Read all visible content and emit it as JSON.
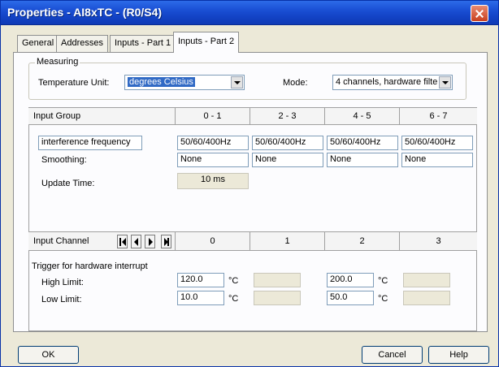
{
  "window": {
    "title": "Properties - AI8xTC - (R0/S4)"
  },
  "tabs": [
    {
      "label": "General"
    },
    {
      "label": "Addresses"
    },
    {
      "label": "Inputs - Part 1"
    },
    {
      "label": "Inputs - Part 2"
    }
  ],
  "measuring": {
    "legend": "Measuring",
    "temp_unit_label": "Temperature Unit:",
    "temp_unit_value": "degrees Celsius",
    "mode_label": "Mode:",
    "mode_value": "4 channels, hardware filte"
  },
  "input_group": {
    "header": "Input Group",
    "columns": [
      "0 - 1",
      "2 - 3",
      "4 - 5",
      "6 - 7"
    ],
    "interference_label": "interference frequency",
    "interference_values": [
      "50/60/400Hz",
      "50/60/400Hz",
      "50/60/400Hz",
      "50/60/400Hz"
    ],
    "smoothing_label": "Smoothing:",
    "smoothing_values": [
      "None",
      "None",
      "None",
      "None"
    ],
    "update_time_label": "Update Time:",
    "update_time_value": "10 ms"
  },
  "input_channel": {
    "header": "Input Channel",
    "columns": [
      "0",
      "1",
      "2",
      "3"
    ],
    "trigger_label": "Trigger for hardware interrupt",
    "high_limit_label": "High Limit:",
    "low_limit_label": "Low Limit:",
    "high_limit_values": [
      "120.0",
      "",
      "200.0",
      ""
    ],
    "low_limit_values": [
      "10.0",
      "",
      "50.0",
      ""
    ],
    "unit": "°C"
  },
  "buttons": {
    "ok": "OK",
    "cancel": "Cancel",
    "help": "Help"
  },
  "colors": {
    "titlebar": "#1a4fd4",
    "selection": "#316ac5",
    "dialog_bg": "#ece9d8"
  }
}
